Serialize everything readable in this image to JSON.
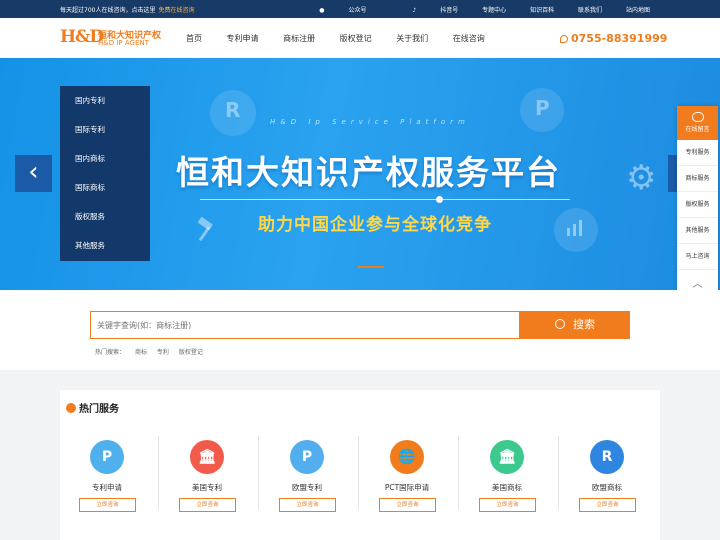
{
  "topbar": {
    "notice": "每天超过700人在线咨询，点击这里",
    "free_consult": "免费在线咨询",
    "links": [
      "公众号",
      "抖音号",
      "专题中心",
      "知识百科",
      "联系我们",
      "站内地图"
    ]
  },
  "header": {
    "logo_mark": "H&D",
    "logo_cn": "恒和大知识产权",
    "logo_en": "H&D IP AGENT",
    "nav": [
      "首页",
      "专利申请",
      "商标注册",
      "版权登记",
      "关于我们",
      "在线咨询"
    ],
    "phone": "0755-88391999"
  },
  "banner": {
    "platform": "H&D Ip Service Platform",
    "title": "恒和大知识产权服务平台",
    "subtitle": "助力中国企业参与全球化竞争",
    "prev": "‹",
    "next": "›",
    "deco_r": "R",
    "deco_p": "P",
    "deco_gear": "⚙"
  },
  "side_menu": [
    "国内专利",
    "国际专利",
    "国内商标",
    "国际商标",
    "版权服务",
    "其他服务"
  ],
  "float_panel": {
    "top": "在线留言",
    "items": [
      "专利服务",
      "商标服务",
      "版权服务",
      "其他服务",
      "马上咨询"
    ],
    "up": "︿"
  },
  "search": {
    "placeholder": "关键字查询(如：商标注册)",
    "button": "搜索",
    "hot_label": "热门搜索：",
    "hot_items": [
      "商标",
      "专利",
      "版权登记"
    ]
  },
  "services": {
    "title": "热门服务",
    "items": [
      {
        "name": "专利申请",
        "button": "立即咨询",
        "color": "#4fb0ee",
        "glyph": "P"
      },
      {
        "name": "美国专利",
        "button": "立即咨询",
        "color": "#f25a4c",
        "glyph": "🏛"
      },
      {
        "name": "欧盟专利",
        "button": "立即咨询",
        "color": "#53aef0",
        "glyph": "P"
      },
      {
        "name": "PCT国际申请",
        "button": "立即咨询",
        "color": "#f07c1e",
        "glyph": "🌐"
      },
      {
        "name": "美国商标",
        "button": "立即咨询",
        "color": "#3dc98d",
        "glyph": "🏛"
      },
      {
        "name": "欧盟商标",
        "button": "立即咨询",
        "color": "#2e86e0",
        "glyph": "R"
      }
    ]
  },
  "colors": {
    "accent": "#f07c1e",
    "topbar": "#173a66",
    "banner": "#1c98e8",
    "side_menu": "#13386a"
  }
}
